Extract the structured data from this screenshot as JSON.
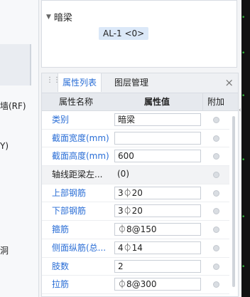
{
  "left_fragments": [
    "墙(RF)",
    "Y)",
    "洞"
  ],
  "tree": {
    "group_label": "暗梁",
    "item_label": "AL-1 <0>"
  },
  "panel": {
    "tabs": [
      "属性列表",
      "图层管理"
    ],
    "active_tab": "属性列表",
    "close_glyph": "×",
    "columns": [
      "属性名称",
      "属性值",
      "附加"
    ],
    "rows": [
      {
        "name": "类别",
        "value": "暗梁",
        "name_color": "blue"
      },
      {
        "name": "截面宽度(mm)",
        "value": "",
        "name_color": "blue"
      },
      {
        "name": "截面高度(mm)",
        "value": "600",
        "name_color": "blue"
      },
      {
        "name": "轴线距梁左...",
        "value": "(0)",
        "name_color": "black"
      },
      {
        "name": "上部钢筋",
        "value": "3⏀20",
        "name_color": "blue"
      },
      {
        "name": "下部钢筋",
        "value": "3⏀20",
        "name_color": "blue"
      },
      {
        "name": "箍筋",
        "value": "⏀8@150",
        "name_color": "blue"
      },
      {
        "name": "侧面纵筋(总...",
        "value": "4⏀14",
        "name_color": "blue"
      },
      {
        "name": "肢数",
        "value": "2",
        "name_color": "blue"
      },
      {
        "name": "拉筋",
        "value": "⏀8@300",
        "name_color": "blue"
      }
    ]
  },
  "colors": {
    "accent": "#2a6ed6",
    "tree_chip_bg": "#dbe8f8",
    "right_strip_bg": "#121212"
  }
}
